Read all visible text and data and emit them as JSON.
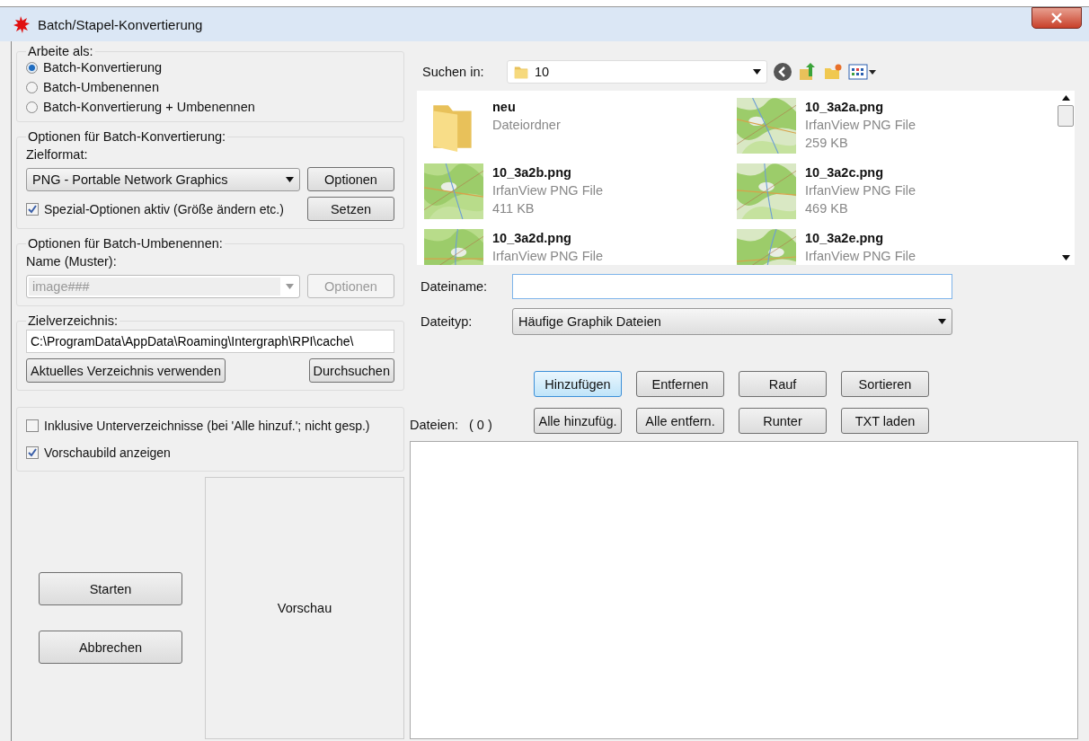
{
  "window": {
    "title": "Batch/Stapel-Konvertierung"
  },
  "work_as": {
    "legend": "Arbeite als:",
    "options": [
      {
        "label": "Batch-Konvertierung",
        "selected": true
      },
      {
        "label": "Batch-Umbenennen",
        "selected": false
      },
      {
        "label": "Batch-Konvertierung + Umbenennen",
        "selected": false
      }
    ]
  },
  "conversion": {
    "legend": "Optionen für Batch-Konvertierung:",
    "format_label": "Zielformat:",
    "format_value": "PNG - Portable Network Graphics",
    "options_button": "Optionen",
    "special": {
      "label": "Spezial-Optionen aktiv (Größe ändern etc.)",
      "checked": true
    },
    "set_button": "Setzen"
  },
  "rename": {
    "legend": "Optionen für Batch-Umbenennen:",
    "name_label": "Name (Muster):",
    "name_value": "image###",
    "disabled": true,
    "options_button": "Optionen"
  },
  "target": {
    "legend": "Zielverzeichnis:",
    "path": "C:\\ProgramData\\AppData\\Roaming\\Intergraph\\RPI\\cache\\",
    "use_current_button": "Aktuelles Verzeichnis verwenden",
    "browse_button": "Durchsuchen"
  },
  "checks": [
    {
      "label": "Inklusive Unterverzeichnisse (bei 'Alle hinzuf.'; nicht gesp.)",
      "checked": false
    },
    {
      "label": "Vorschaubild anzeigen",
      "checked": true
    }
  ],
  "buttons": [
    "Starten",
    "Abbrechen"
  ],
  "preview": {
    "label": "Vorschau"
  },
  "browser": {
    "look_in_label": "Suchen in:",
    "folder": "10",
    "files": [
      {
        "kind": "folder",
        "name": "neu",
        "type": "Dateiordner"
      },
      {
        "kind": "picture",
        "name": "10_3a2a.png",
        "type": "IrfanView PNG File",
        "size": "259 KB"
      },
      {
        "kind": "picture",
        "name": "10_3a2b.png",
        "type": "IrfanView PNG File",
        "size": "411 KB"
      },
      {
        "kind": "picture",
        "name": "10_3a2c.png",
        "type": "IrfanView PNG File",
        "size": "469 KB"
      },
      {
        "kind": "picture",
        "name": "10_3a2d.png",
        "type": "IrfanView PNG File"
      },
      {
        "kind": "picture",
        "name": "10_3a2e.png",
        "type": "IrfanView PNG File"
      }
    ]
  },
  "filename": {
    "label": "Dateiname:"
  },
  "filetype": {
    "label": "Dateityp:",
    "value": "Häufige Graphik Dateien"
  },
  "list_buttons": [
    {
      "label": "Hinzufügen",
      "focused": true
    },
    {
      "label": "Entfernen",
      "focused": false
    },
    {
      "label": "Rauf",
      "focused": false
    },
    {
      "label": "Sortieren",
      "focused": false
    },
    {
      "label": "Alle hinzufüg.",
      "focused": false
    },
    {
      "label": "Alle entfern.",
      "focused": false
    },
    {
      "label": "Runter",
      "focused": false
    },
    {
      "label": "TXT laden",
      "focused": false
    }
  ],
  "files_label": "Dateien:",
  "files_count": "( 0 )"
}
